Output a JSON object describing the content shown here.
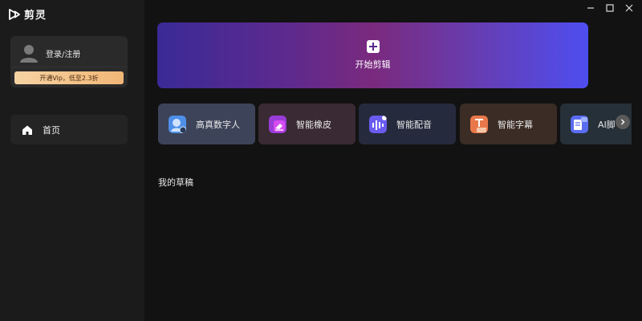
{
  "app": {
    "name": "剪灵"
  },
  "user": {
    "login_label": "登录/注册",
    "vip_label": "开通Vip，低至2.3折"
  },
  "nav": {
    "items": [
      {
        "label": "首页",
        "icon": "home-icon"
      }
    ]
  },
  "hero": {
    "label": "开始剪辑"
  },
  "tools": [
    {
      "label": "高真数字人",
      "icon": "digital-human-icon",
      "color": "#4f8fe8"
    },
    {
      "label": "智能橡皮",
      "icon": "eraser-icon",
      "color": "#c84cf0"
    },
    {
      "label": "智能配音",
      "icon": "voice-wave-icon",
      "color": "#6a5cf0"
    },
    {
      "label": "智能字幕",
      "icon": "subtitle-icon",
      "color": "#e8784a"
    },
    {
      "label": "AI脚",
      "icon": "ai-script-icon",
      "color": "#5a6cf0"
    }
  ],
  "drafts": {
    "title": "我的草稿"
  },
  "colors": {
    "vip": "#f1b676",
    "hero_start": "#3a2a96",
    "hero_end": "#4e4ef0"
  }
}
